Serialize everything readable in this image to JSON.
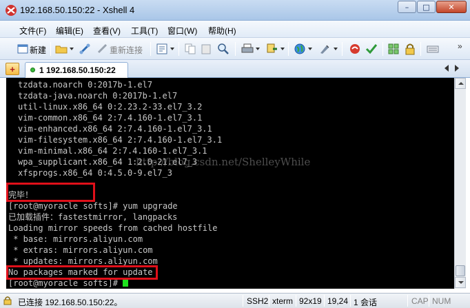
{
  "window": {
    "title": "192.168.50.150:22 - Xshell 4"
  },
  "menu": {
    "items": [
      "文件(F)",
      "编辑(E)",
      "查看(V)",
      "工具(T)",
      "窗口(W)",
      "帮助(H)"
    ]
  },
  "toolbar": {
    "new_label": "新建",
    "reconnect_label": "重新连接"
  },
  "tabs": {
    "add_label": "+",
    "active_label": "1 192.168.50.150:22"
  },
  "terminal": {
    "lines": [
      "tzdata.noarch 0:2017b-1.el7",
      "tzdata-java.noarch 0:2017b-1.el7",
      "util-linux.x86_64 0:2.23.2-33.el7_3.2",
      "vim-common.x86_64 2:7.4.160-1.el7_3.1",
      "vim-enhanced.x86_64 2:7.4.160-1.el7_3.1",
      "vim-filesystem.x86_64 2:7.4.160-1.el7_3.1",
      "vim-minimal.x86_64 2:7.4.160-1.el7_3.1",
      "wpa_supplicant.x86_64 1:2.0-21.el7_3",
      "xfsprogs.x86_64 0:4.5.0-9.el7_3",
      "",
      "完毕！",
      "[root@myoracle softs]# yum upgrade",
      "已加载插件：fastestmirror, langpacks",
      "Loading mirror speeds from cached hostfile",
      " * base: mirrors.aliyun.com",
      " * extras: mirrors.aliyun.com",
      " * updates: mirrors.aliyun.com",
      "No packages marked for update",
      "[root@myoracle softs]# "
    ],
    "watermark": "http://blog.csdn.net/ShelleyWhile"
  },
  "status": {
    "connection": "已连接 192.168.50.150:22。",
    "protocol": "SSH2",
    "term_type": "xterm",
    "size": "92x19",
    "position": "19,24",
    "sessions": "1 会话",
    "caps": "CAP",
    "num": "NUM"
  },
  "colors": {
    "terminal_bg": "#000000",
    "terminal_fg": "#c8c8c8",
    "cursor": "#1ee21e",
    "highlight": "#e0101a"
  }
}
